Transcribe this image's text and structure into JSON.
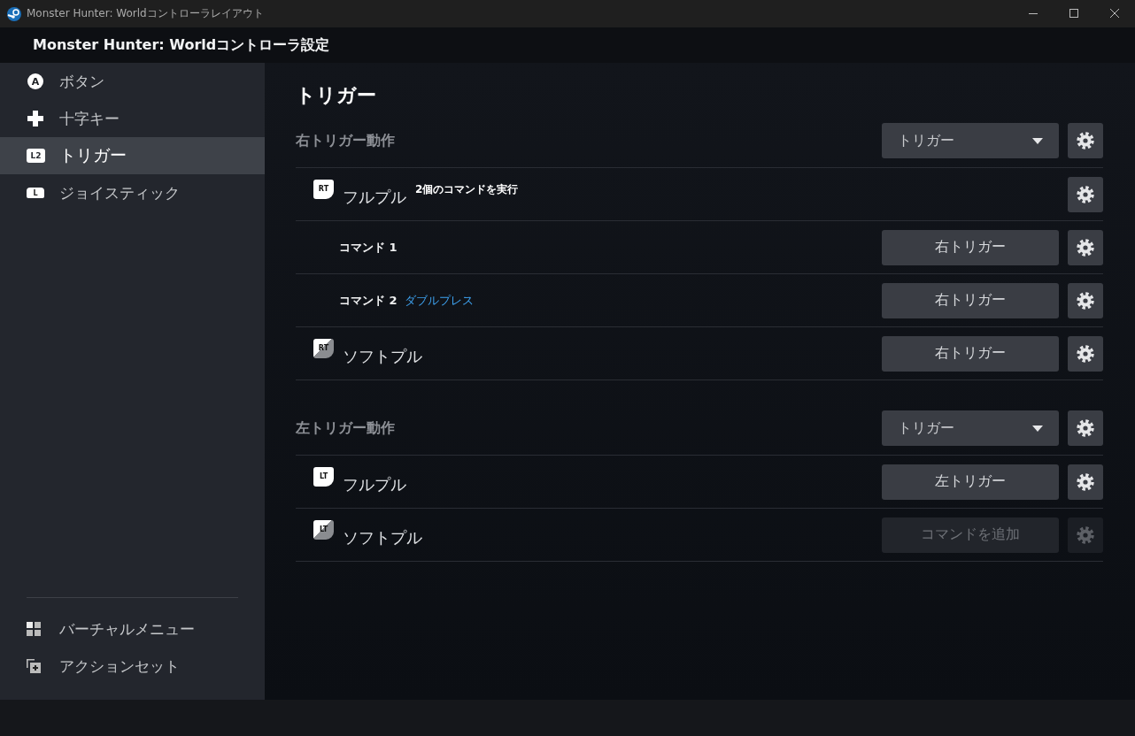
{
  "window": {
    "title": "Monster Hunter: Worldコントローラレイアウト"
  },
  "header": {
    "title": "Monster Hunter: Worldコントローラ設定"
  },
  "sidebar": {
    "items": [
      {
        "kind": "face_button",
        "badge": "A",
        "label": "ボタン",
        "selected": false
      },
      {
        "kind": "dpad",
        "label": "十字キー",
        "selected": false
      },
      {
        "kind": "trigger",
        "badge": "L2",
        "label": "トリガー",
        "selected": true
      },
      {
        "kind": "joystick",
        "badge": "L",
        "label": "ジョイスティック",
        "selected": false
      }
    ],
    "footer_items": [
      {
        "kind": "grid",
        "label": "バーチャルメニュー"
      },
      {
        "kind": "action_set",
        "label": "アクションセット"
      }
    ]
  },
  "content": {
    "title": "トリガー",
    "sections": [
      {
        "title": "右トリガー動作",
        "mode": "トリガー",
        "rows": [
          {
            "kind": "full_pull",
            "badge": "RT",
            "label": "フルプル",
            "note": "2個のコマンドを実行"
          },
          {
            "kind": "command",
            "label": "コマンド 1",
            "button": {
              "label": "右トリガー",
              "disabled": false
            }
          },
          {
            "kind": "command",
            "label": "コマンド 2",
            "modifier": "ダブルプレス",
            "button": {
              "label": "右トリガー",
              "disabled": false
            }
          },
          {
            "kind": "soft_pull",
            "badge": "RT",
            "label": "ソフトプル",
            "button": {
              "label": "右トリガー",
              "disabled": false
            }
          }
        ]
      },
      {
        "title": "左トリガー動作",
        "mode": "トリガー",
        "rows": [
          {
            "kind": "full_pull",
            "badge": "LT",
            "label": "フルプル",
            "button": {
              "label": "左トリガー",
              "disabled": false
            }
          },
          {
            "kind": "soft_pull",
            "badge": "LT",
            "label": "ソフトプル",
            "button": {
              "label": "コマンドを追加",
              "disabled": true
            }
          }
        ]
      }
    ]
  }
}
